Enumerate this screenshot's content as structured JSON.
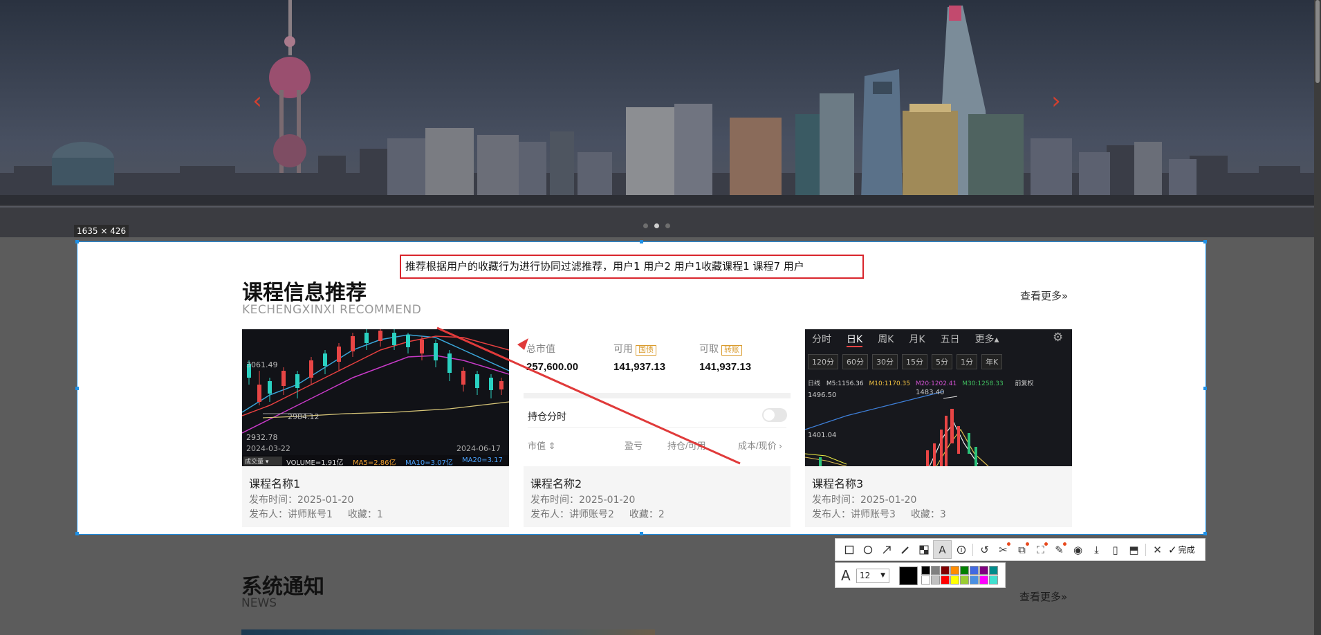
{
  "capture": {
    "size_label": "1635 × 426"
  },
  "hero": {
    "prev_arrow": "‹",
    "next_arrow": "›"
  },
  "recommend": {
    "title": "课程信息推荐",
    "subtitle": "KECHENGXINXI RECOMMEND",
    "see_more": "查看更多»",
    "annotation_text": "推荐根据用户的收藏行为进行协同过滤推荐，用户1 用户2 用户1收藏课程1 课程7 用户"
  },
  "courses": [
    {
      "name": "课程名称1",
      "date": "发布时间：2025-01-20",
      "author": "发布人：讲师账号1",
      "fav": "收藏：1"
    },
    {
      "name": "课程名称2",
      "date": "发布时间：2025-01-20",
      "author": "发布人：讲师账号2",
      "fav": "收藏：2"
    },
    {
      "name": "课程名称3",
      "date": "发布时间：2025-01-20",
      "author": "发布人：讲师账号3",
      "fav": "收藏：3"
    }
  ],
  "card1_img": {
    "label_top": "3061.49",
    "label_mid": "2984.12",
    "label_low": "2932.78",
    "date_left": "2024-03-22",
    "date_right": "2024-06-17",
    "legend": {
      "vol_btn": "成交量 ▾",
      "volume": "VOLUME=1.91亿",
      "ma5": "MA5=2.86亿",
      "ma10": "MA10=3.07亿",
      "ma20": "MA20=3.17"
    }
  },
  "card2_img": {
    "l1": "总市值",
    "v1": "257,600.00",
    "l2": "可用",
    "t2": "国债",
    "v2": "141,937.13",
    "l3": "可取",
    "t3": "转账",
    "v3": "141,937.13",
    "position_label": "持仓分时",
    "col1": "市值 ⇕",
    "col2": "盈亏",
    "col3": "持仓/可用",
    "col4": "成本/现价 ›"
  },
  "card3_img": {
    "tabs": [
      "分时",
      "日K",
      "周K",
      "月K",
      "五日",
      "更多▴"
    ],
    "periods": [
      "120分",
      "60分",
      "30分",
      "15分",
      "5分",
      "1分",
      "年K"
    ],
    "ma_line": {
      "day": "日线",
      "ma5": "M5:1156.36",
      "ma10": "M10:1170.35",
      "ma20": "M20:1202.41",
      "ma30": "M30:1258.33",
      "fq": "前复权"
    },
    "p_top": "1496.50",
    "p_peak": "1483.40",
    "p_low": "1401.04"
  },
  "toolbar": {
    "icons": [
      "rect-icon",
      "ellipse-icon",
      "arrow-icon",
      "pen-icon",
      "mosaic-icon",
      "text-icon",
      "number-icon",
      "undo-icon",
      "scissors-icon",
      "ocr-icon",
      "translate-icon",
      "pin-icon",
      "record-icon",
      "save-icon",
      "long-screenshot-icon",
      "bookmark-icon",
      "cancel-icon"
    ],
    "done": "完成",
    "font_size": "12",
    "font_glyph": "A",
    "palette": [
      "#000000",
      "#808080",
      "#800000",
      "#ff8c00",
      "#008000",
      "#4169e1",
      "#800080",
      "#008b8b",
      "#ffffff",
      "#c0c0c0",
      "#ff0000",
      "#ffff00",
      "#9acd32",
      "#4a90e2",
      "#ff00ff",
      "#40e0d0"
    ]
  },
  "news": {
    "title": "系统通知",
    "subtitle": "NEWS",
    "see_more": "查看更多»"
  }
}
